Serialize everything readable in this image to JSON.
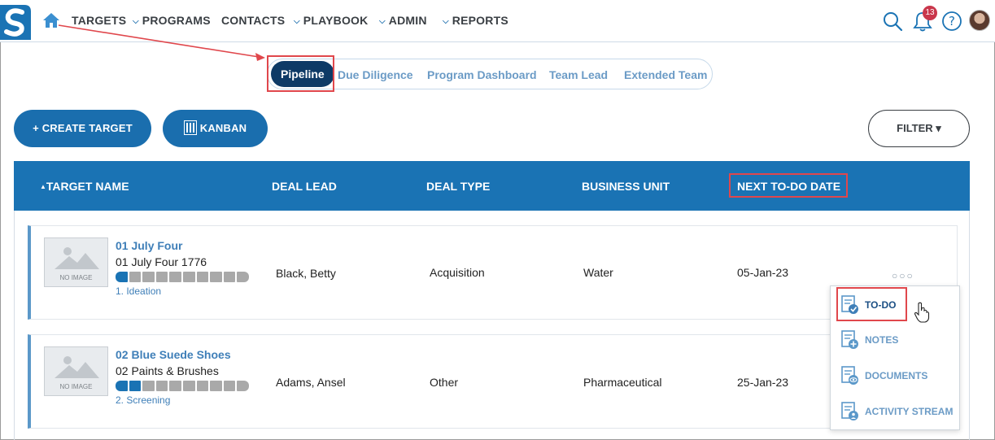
{
  "nav": {
    "items": [
      {
        "label": "TARGETS",
        "chevron": false
      },
      {
        "label": "PROGRAMS",
        "chevron": true
      },
      {
        "label": "CONTACTS",
        "chevron": false
      },
      {
        "label": "PLAYBOOK",
        "chevron": true
      },
      {
        "label": "ADMIN",
        "chevron": true
      },
      {
        "label": "REPORTS",
        "chevron": true
      }
    ],
    "notification_count": "13"
  },
  "tabs": [
    "Pipeline",
    "Due Diligence",
    "Program Dashboard",
    "Team Lead",
    "Extended Team"
  ],
  "actions": {
    "create_target": "+ CREATE TARGET",
    "kanban": "KANBAN",
    "filter": "FILTER ▾"
  },
  "table": {
    "headers": [
      "TARGET NAME",
      "DEAL LEAD",
      "DEAL TYPE",
      "BUSINESS UNIT",
      "NEXT TO-DO DATE"
    ],
    "no_image_label": "NO IMAGE",
    "rows": [
      {
        "name": "01 July Four",
        "subtitle": "01 July Four 1776",
        "stage": "1. Ideation",
        "stage_progress": 1,
        "stage_total": 10,
        "deal_lead": "Black, Betty",
        "deal_type": "Acquisition",
        "business_unit": "Water",
        "next_todo": "05-Jan-23"
      },
      {
        "name": "02 Blue Suede Shoes",
        "subtitle": "02 Paints & Brushes",
        "stage": "2. Screening",
        "stage_progress": 2,
        "stage_total": 10,
        "deal_lead": "Adams, Ansel",
        "deal_type": "Other",
        "business_unit": "Pharmaceutical",
        "next_todo": "25-Jan-23"
      }
    ]
  },
  "menu": {
    "more_label": "○○○",
    "items": [
      "TO-DO",
      "NOTES",
      "DOCUMENTS",
      "ACTIVITY STREAM"
    ]
  },
  "colors": {
    "primary": "#1a73b4",
    "active_tab": "#0e3a66",
    "highlight": "#e0474c",
    "badge": "#c9364b"
  }
}
